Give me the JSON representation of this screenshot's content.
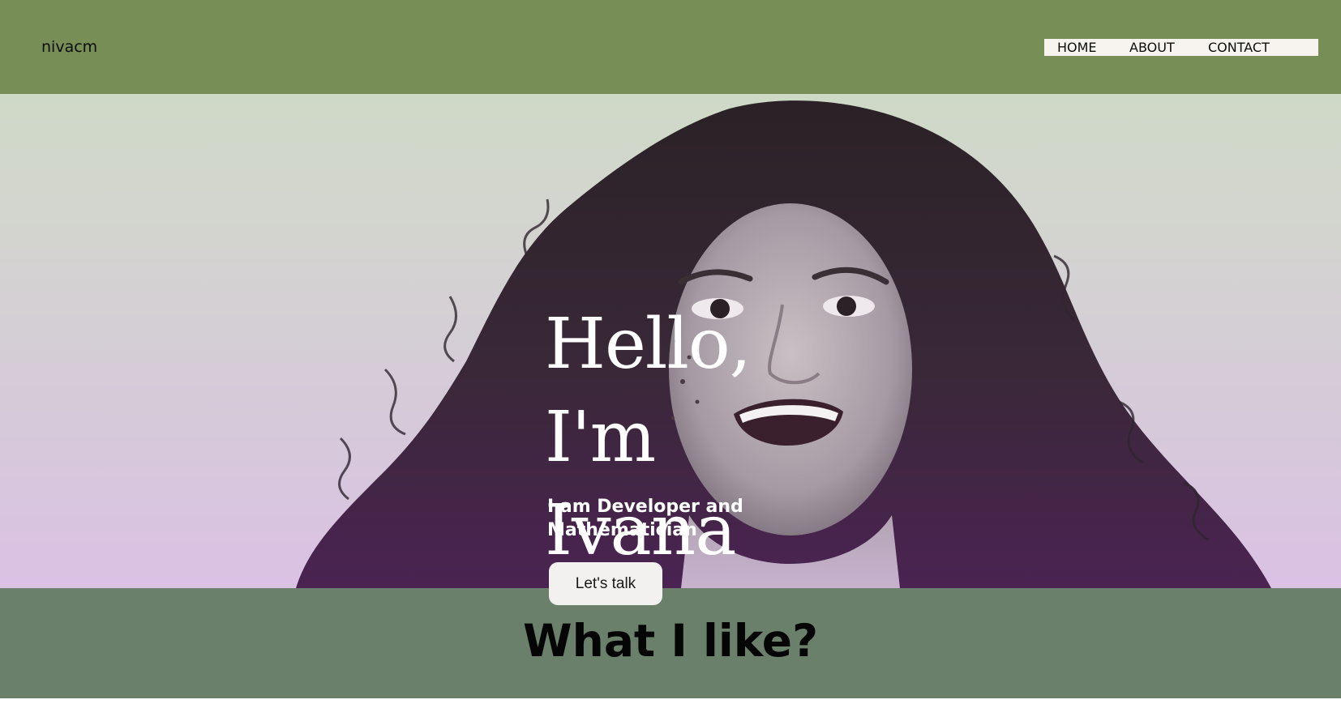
{
  "header": {
    "brand": "nivacm",
    "nav": [
      {
        "label": "HOME"
      },
      {
        "label": "ABOUT"
      },
      {
        "label": "CONTACT"
      }
    ]
  },
  "hero": {
    "title_line1": "Hello,",
    "title_line2": "I'm",
    "title_line3": "Ivana",
    "subtitle": "I am Developer and Mathematician",
    "cta_label": "Let's talk"
  },
  "section": {
    "title": "What I like?"
  },
  "colors": {
    "header_bg": "#778f56",
    "band_bg": "#6b806a",
    "hero_top": "#cfd9c7",
    "hero_bottom": "#dbc1e4"
  }
}
